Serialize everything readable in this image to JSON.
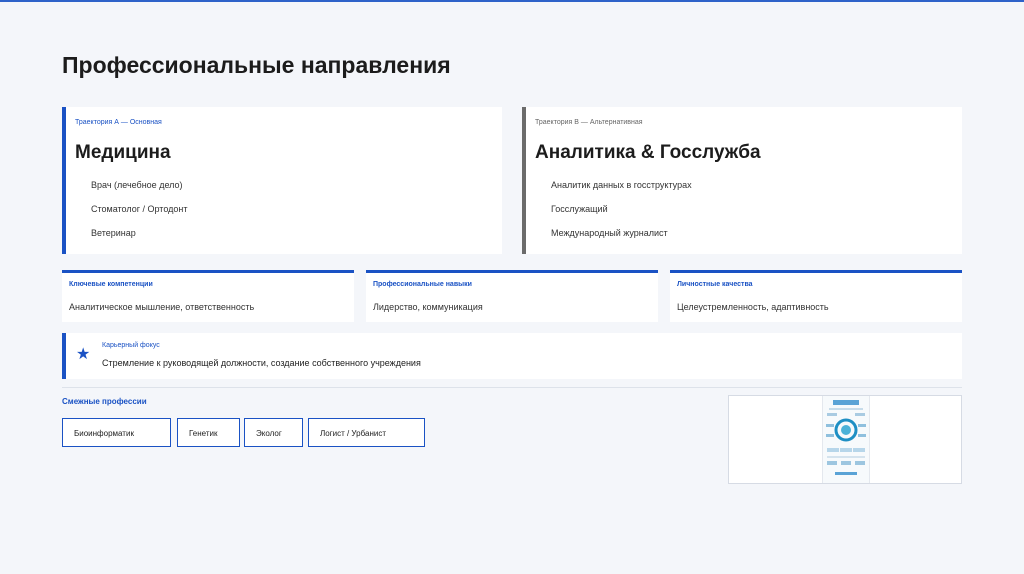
{
  "title": "Профессиональные направления",
  "trajectories": [
    {
      "tag": "Траектория А — Основная",
      "name": "Медицина",
      "items": [
        "Врач (лечебное дело)",
        "Стоматолог / Ортодонт",
        "Ветеринар"
      ]
    },
    {
      "tag": "Траектория В — Альтернативная",
      "name": "Аналитика & Госслужба",
      "items": [
        "Аналитик данных в госструктурах",
        "Госслужащий",
        "Международный журналист"
      ]
    }
  ],
  "competencies": [
    {
      "heading": "Ключевые компетенции",
      "value": "Аналитическое мышление, ответственность"
    },
    {
      "heading": "Профессиональные навыки",
      "value": "Лидерство, коммуникация"
    },
    {
      "heading": "Личностные качества",
      "value": "Целеустремленность, адаптивность"
    }
  ],
  "career_focus": {
    "heading": "Карьерный фокус",
    "value": "Стремление к руководящей должности, создание собственного учреждения",
    "icon": "star-icon"
  },
  "related": {
    "heading": "Смежные профессии",
    "items": [
      "Биоинформатик",
      "Генетик",
      "Эколог",
      "Логист / Урбанист"
    ]
  },
  "colors": {
    "accent": "#1a52c4",
    "secondary": "#6b6b6b",
    "background": "#f4f6fa"
  }
}
